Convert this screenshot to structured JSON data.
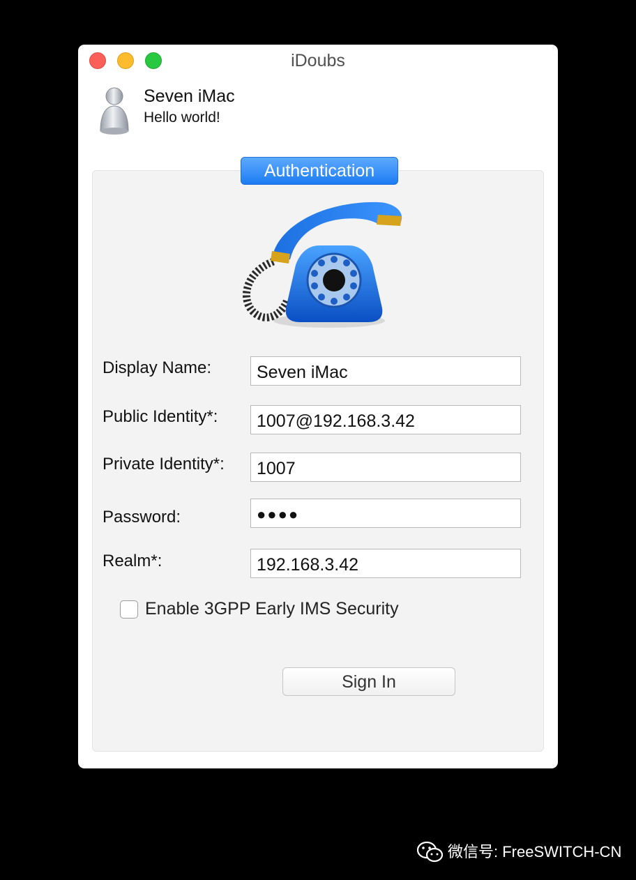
{
  "window": {
    "title": "iDoubs"
  },
  "user": {
    "name": "Seven iMac",
    "status": "Hello world!"
  },
  "tab": {
    "label": "Authentication"
  },
  "form": {
    "display_name": {
      "label": "Display Name:",
      "value": "Seven iMac"
    },
    "public_identity": {
      "label": "Public Identity*:",
      "value": "1007@192.168.3.42"
    },
    "private_identity": {
      "label": "Private Identity*:",
      "value": "1007"
    },
    "password": {
      "label": "Password:",
      "value": "●●●●"
    },
    "realm": {
      "label": "Realm*:",
      "value": "192.168.3.42"
    },
    "early_ims": {
      "label": "Enable 3GPP Early IMS Security",
      "checked": false
    }
  },
  "buttons": {
    "sign_in": "Sign In"
  },
  "watermark": {
    "text": "微信号: FreeSWITCH-CN"
  },
  "colors": {
    "accent": "#1d7cf2",
    "close": "#fc5f57",
    "minimize": "#fdbc2e",
    "zoom": "#28c840"
  }
}
